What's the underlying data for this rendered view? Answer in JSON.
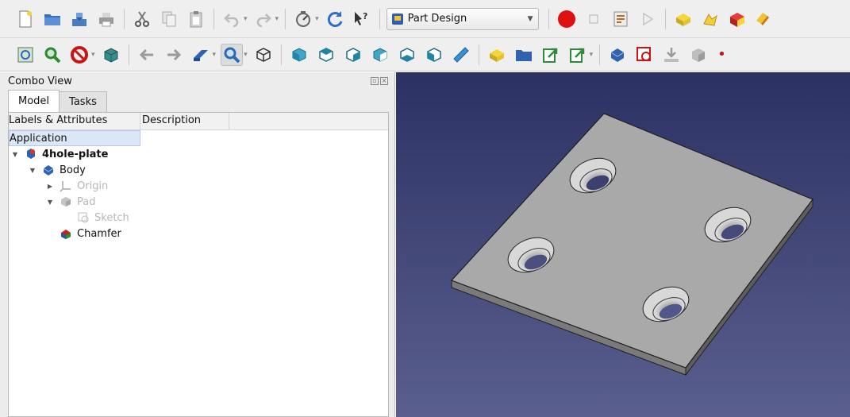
{
  "toolbar1": {
    "workbench": "Part Design"
  },
  "combo": {
    "title": "Combo View",
    "tabs": [
      {
        "label": "Model",
        "active": true
      },
      {
        "label": "Tasks",
        "active": false
      }
    ],
    "columns": [
      "Labels & Attributes",
      "Description"
    ],
    "tree": {
      "root": "Application",
      "document": "4hole-plate",
      "body": "Body",
      "origin": "Origin",
      "pad": "Pad",
      "sketch": "Sketch",
      "chamfer": "Chamfer"
    }
  },
  "icons": {
    "toolbar1": [
      "new-document-icon",
      "open-folder-icon",
      "save-icon",
      "print-icon",
      "cut-icon",
      "copy-icon",
      "paste-icon",
      "undo-icon",
      "redo-icon",
      "refresh-icon",
      "whats-this-icon",
      "record-macro-icon",
      "stop-macro-icon",
      "macros-icon",
      "run-macro-icon",
      "part-icon"
    ],
    "toolbar2": [
      "fit-all-icon",
      "fit-selection-icon",
      "draw-style-icon",
      "bounding-box-icon",
      "back-arrow-icon",
      "forward-arrow-icon",
      "sync-view-icon",
      "zoom-icon",
      "isometric-view-icon",
      "front-view-icon",
      "top-view-icon",
      "right-view-icon",
      "rear-view-icon",
      "bottom-view-icon",
      "left-view-icon",
      "measure-icon",
      "create-part-icon",
      "create-group-icon",
      "link-icon",
      "link-actions-icon",
      "create-body-icon",
      "create-sketch-icon",
      "validate-sketch-icon",
      "pad-icon"
    ]
  },
  "colors": {
    "viewport_top": "#2c3163",
    "viewport_bottom": "#5a5f8f",
    "plate_face": "#a9a9a9",
    "record_button": "#e01010"
  }
}
